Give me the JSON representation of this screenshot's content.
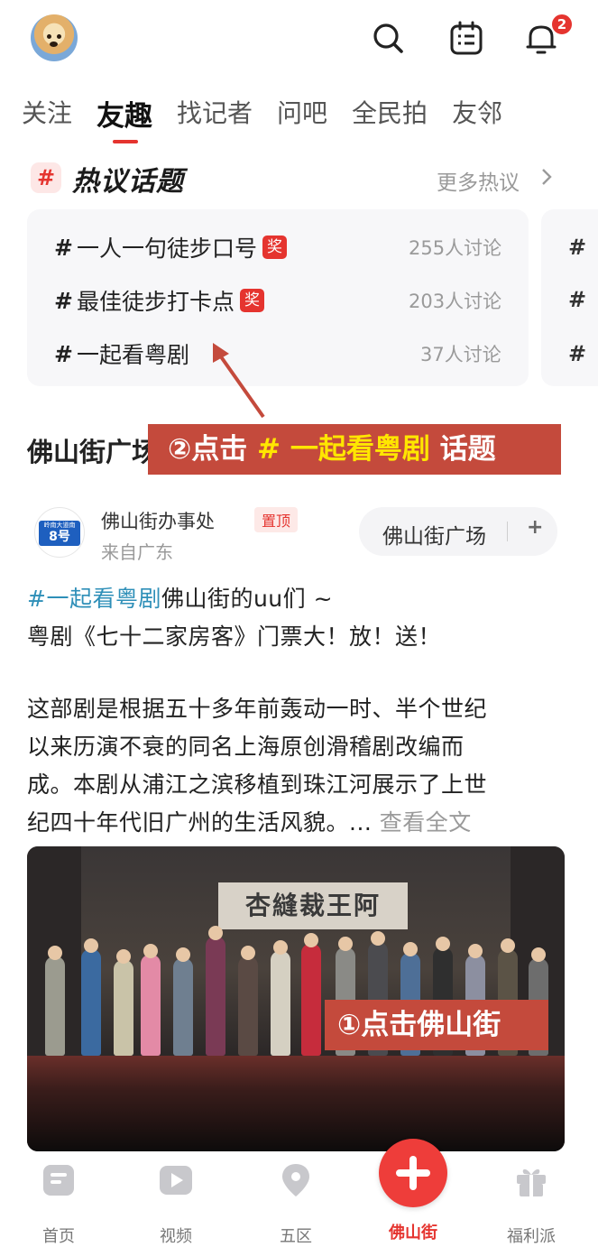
{
  "header": {
    "notification_count": "2",
    "icons": [
      "avatar",
      "search-icon",
      "calendar-icon",
      "bell-icon"
    ]
  },
  "tabs": [
    {
      "label": "关注"
    },
    {
      "label": "友趣",
      "active": true
    },
    {
      "label": "找记者"
    },
    {
      "label": "问吧"
    },
    {
      "label": "全民拍"
    },
    {
      "label": "友邻"
    }
  ],
  "hot_topics": {
    "hash": "#",
    "title": "热议话题",
    "more_label": "更多热议",
    "items": [
      {
        "hash": "#",
        "name": "一人一句徒步口号",
        "award": "奖",
        "count": "255人讨论"
      },
      {
        "hash": "#",
        "name": "最佳徒步打卡点",
        "award": "奖",
        "count": "203人讨论"
      },
      {
        "hash": "#",
        "name": "一起看粤剧",
        "count": "37人讨论"
      }
    ]
  },
  "annotations": {
    "step2_prefix": "②点击 ",
    "step2_highlight": "# 一起看粤剧",
    "step2_suffix": " 话题",
    "step1": "①点击佛山街"
  },
  "section_title": "佛山街广场",
  "post": {
    "avatar_sign_top": "岭南大道南",
    "avatar_sign_num": "8号",
    "author": "佛山街办事处",
    "pin_label": "置顶",
    "from": "来自广东",
    "follow_label": "佛山街广场",
    "follow_plus": "+",
    "tag": "#一起看粤剧",
    "line1_rest": "佛山街的uu们 ~",
    "line2": "粤剧《七十二家房客》门票大！放！送！",
    "line3": "这部剧是根据五十多年前轰动一时、半个世纪",
    "line4": "以来历演不衰的同名上海原创滑稽剧改编而",
    "line5": "成。本剧从浦江之滨移植到珠江河展示了上世",
    "line6": "纪四十年代旧广州的生活风貌。... ",
    "see_more": "查看全文",
    "photo_banner": "杏縫裁王阿"
  },
  "bottom_nav": [
    {
      "label": "首页"
    },
    {
      "label": "视频"
    },
    {
      "label": "五区"
    },
    {
      "label": "佛山街",
      "active": true
    },
    {
      "label": "福利派"
    }
  ],
  "colors": {
    "accent": "#e5342f",
    "annotation_bg": "#c44a3c",
    "annotation_highlight": "#ffe600",
    "tag": "#2e8fb8"
  }
}
